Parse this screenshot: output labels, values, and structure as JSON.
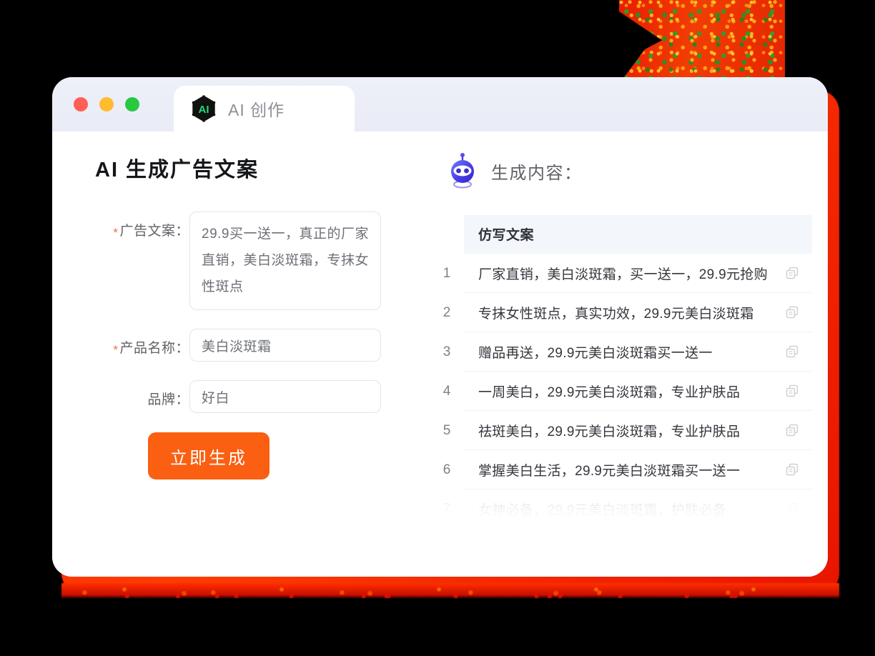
{
  "window": {
    "traffic_lights": [
      {
        "name": "close",
        "color": "#ff5f57"
      },
      {
        "name": "minimize",
        "color": "#febc2e"
      },
      {
        "name": "maximize",
        "color": "#28c840"
      }
    ],
    "tab": {
      "label": "AI 创作",
      "logo_text": "AI",
      "logo_icon": "ai-hexagon-logo"
    }
  },
  "left_panel": {
    "title": "AI 生成广告文案",
    "fields": [
      {
        "label": "广告文案：",
        "required": true,
        "type": "textarea",
        "value": "29.9买一送一，真正的厂家直销，美白淡斑霜，专抹女性斑点"
      },
      {
        "label": "产品名称：",
        "required": true,
        "type": "input",
        "value": "美白淡斑霜"
      },
      {
        "label": "品牌：",
        "required": false,
        "type": "input",
        "value": "好白"
      }
    ],
    "submit_button": {
      "label": "立即生成",
      "color": "#fa5f12"
    }
  },
  "right_panel": {
    "heading": "生成内容：",
    "heading_icon": "robot-icon",
    "table": {
      "column_header": "仿写文案",
      "copy_icon": "copy-icon",
      "rows": [
        {
          "num": "1",
          "text": "厂家直销，美白淡斑霜，买一送一，29.9元抢购",
          "faded": false
        },
        {
          "num": "2",
          "text": "专抹女性斑点，真实功效，29.9元美白淡斑霜",
          "faded": false
        },
        {
          "num": "3",
          "text": "赠品再送，29.9元美白淡斑霜买一送一",
          "faded": false
        },
        {
          "num": "4",
          "text": "一周美白，29.9元美白淡斑霜，专业护肤品",
          "faded": false
        },
        {
          "num": "5",
          "text": "祛斑美白，29.9元美白淡斑霜，专业护肤品",
          "faded": false
        },
        {
          "num": "6",
          "text": "掌握美白生活，29.9元美白淡斑霜买一送一",
          "faded": false
        },
        {
          "num": "7",
          "text": "女神必备，29.9元美白淡斑霜，护肤必备",
          "faded": true
        }
      ]
    }
  },
  "decoration": {
    "accent_red": "#e81c00",
    "accent_orange": "#fa5f12",
    "header_bg": "#f3f6fb"
  }
}
